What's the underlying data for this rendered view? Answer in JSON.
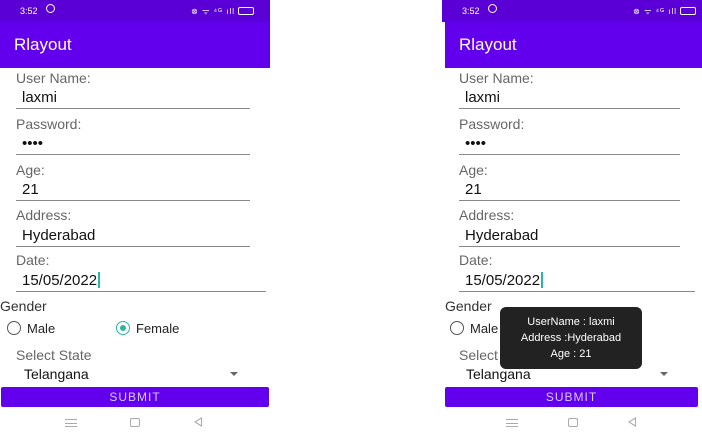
{
  "status": {
    "time": "3:52",
    "icons": "⊗ ᯤ ⁴ᴳ ıll",
    "battery": "48"
  },
  "app": {
    "title": "Rlayout"
  },
  "form": {
    "username_label": "User Name:",
    "username_value": "laxmi",
    "password_label": "Password:",
    "password_value": "••••",
    "age_label": "Age:",
    "age_value": "21",
    "address_label": "Address:",
    "address_value": "Hyderabad",
    "date_label": "Date:",
    "date_value": "15/05/2022",
    "gender_label": "Gender",
    "gender_options": [
      "Male",
      "Female"
    ],
    "gender_selected": "Female",
    "state_label": "Select State",
    "state_value": "Telangana",
    "submit_label": "SUBMIT"
  },
  "toast": {
    "line1": "UserName : laxmi",
    "line2": "Address :Hyderabad",
    "line3": "Age : 21"
  },
  "colors": {
    "status_bar": "#5a00d6",
    "app_bar": "#6200ee",
    "accent": "#2bb5a8"
  }
}
